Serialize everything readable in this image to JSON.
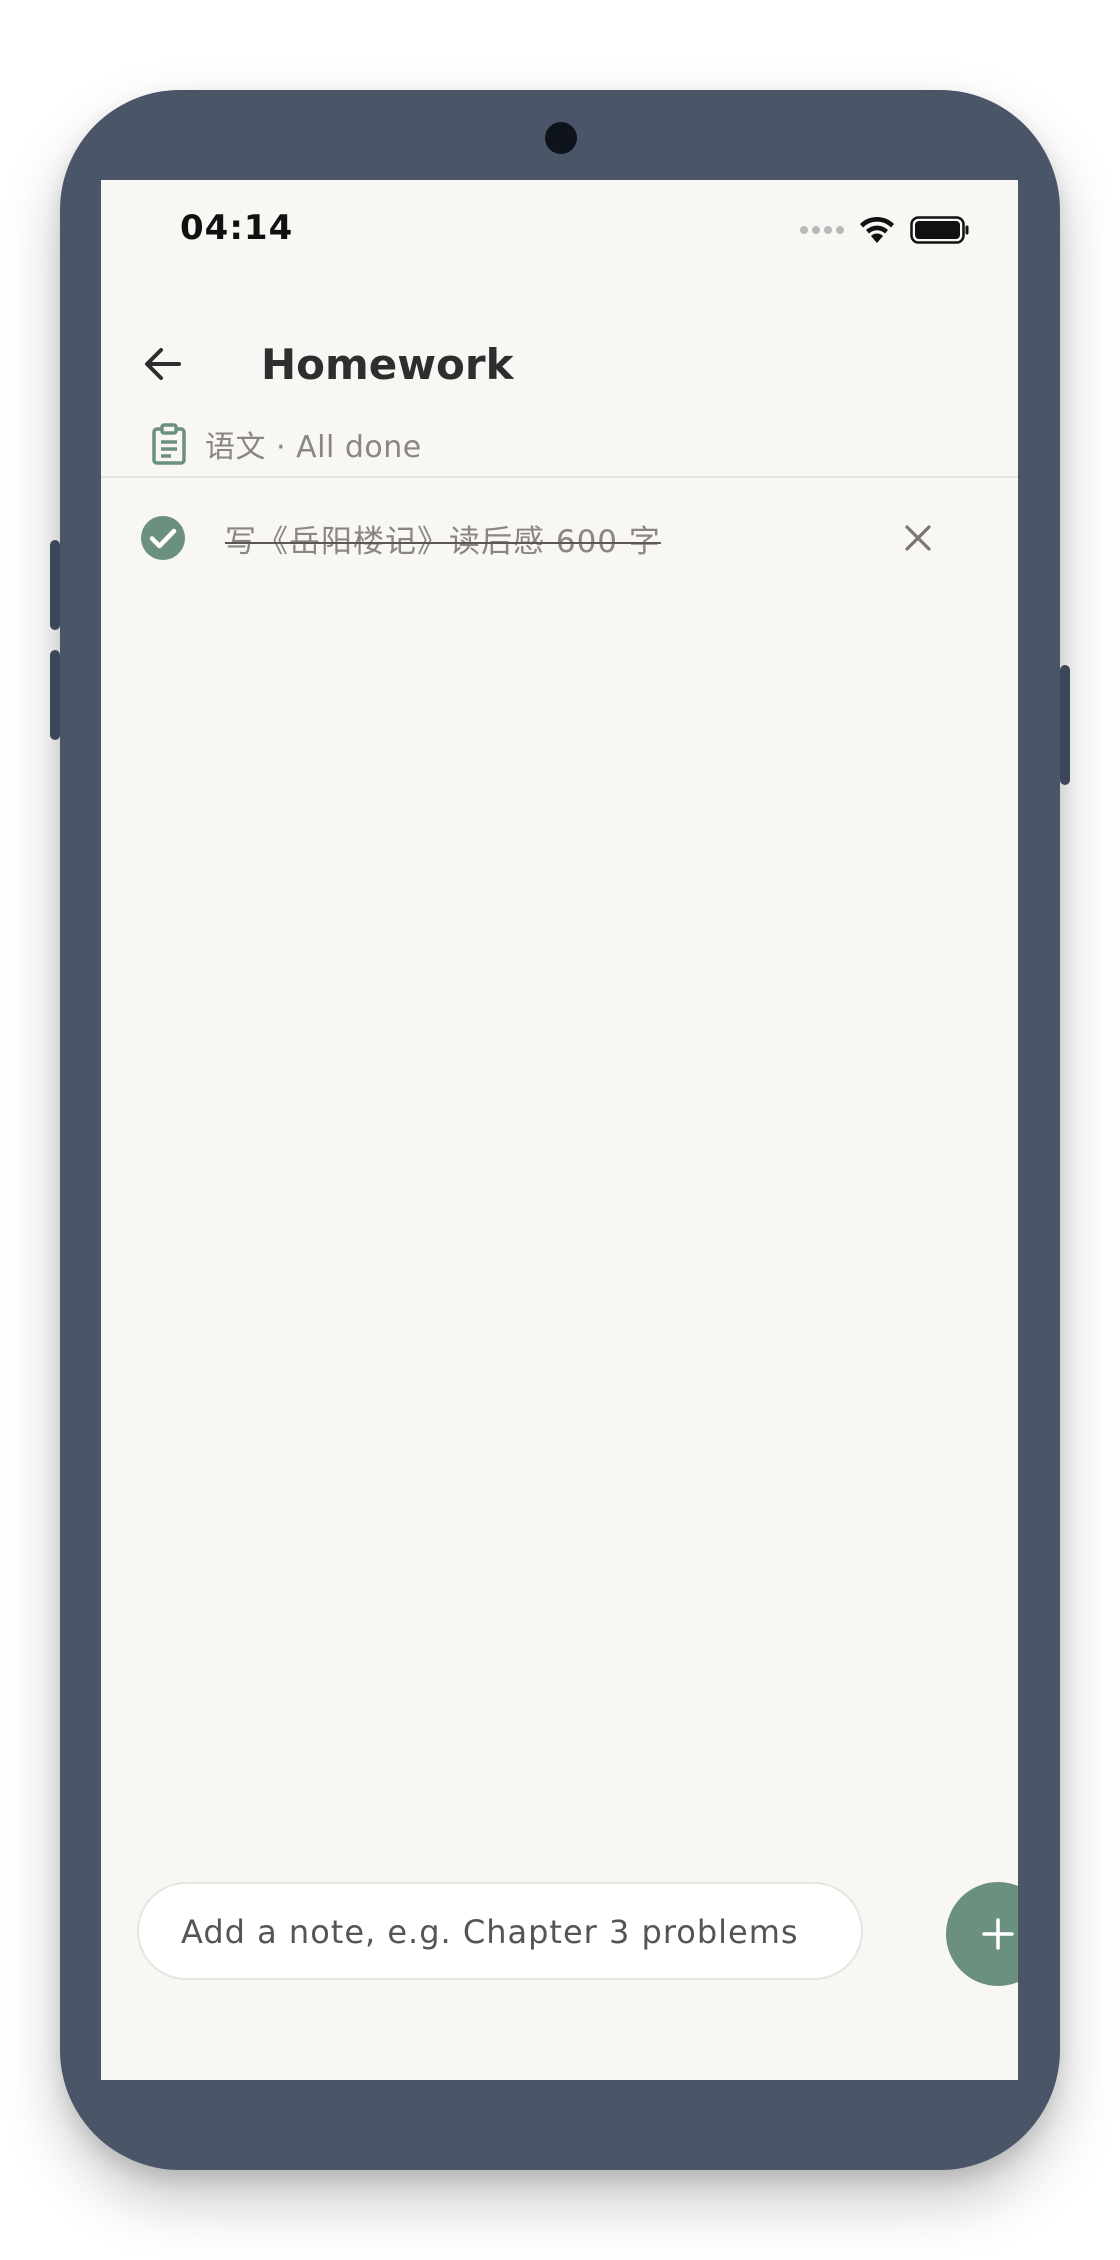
{
  "status_bar": {
    "time": "04:14"
  },
  "header": {
    "title": "Homework"
  },
  "subheader": {
    "text": "语文 · All done"
  },
  "tasks": [
    {
      "text": "写《岳阳楼记》读后感 600 字",
      "done": true
    }
  ],
  "composer": {
    "placeholder": "Add a note, e.g. Chapter 3 problems",
    "value": ""
  },
  "colors": {
    "accent": "#6b9080",
    "frame": "#4a5568",
    "screen_bg": "#f8f7f3",
    "muted_text": "#8a8780"
  },
  "icons": {
    "back": "arrow-left-icon",
    "clipboard": "clipboard-icon",
    "check": "check-circle-icon",
    "delete": "close-icon",
    "add": "plus-icon",
    "wifi": "wifi-icon",
    "battery": "battery-icon",
    "signal": "signal-icon"
  }
}
